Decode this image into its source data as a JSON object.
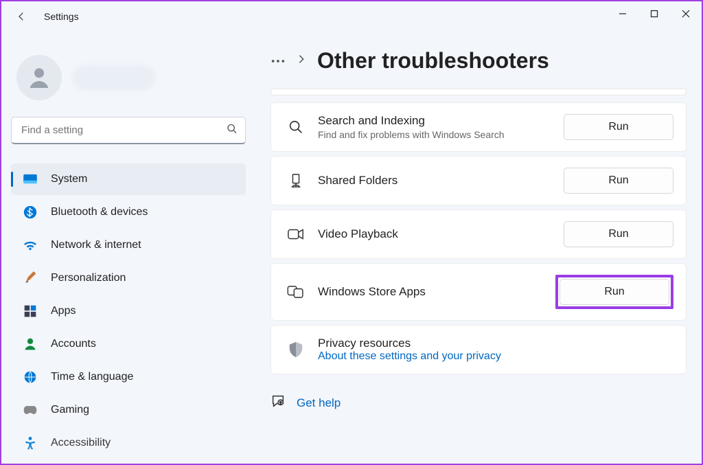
{
  "app_title": "Settings",
  "search": {
    "placeholder": "Find a setting"
  },
  "sidebar": {
    "items": [
      {
        "label": "System",
        "icon": "system",
        "selected": true
      },
      {
        "label": "Bluetooth & devices",
        "icon": "bluetooth"
      },
      {
        "label": "Network & internet",
        "icon": "wifi"
      },
      {
        "label": "Personalization",
        "icon": "brush"
      },
      {
        "label": "Apps",
        "icon": "apps"
      },
      {
        "label": "Accounts",
        "icon": "account"
      },
      {
        "label": "Time & language",
        "icon": "time"
      },
      {
        "label": "Gaming",
        "icon": "gaming"
      },
      {
        "label": "Accessibility",
        "icon": "accessibility"
      }
    ]
  },
  "page": {
    "title": "Other troubleshooters"
  },
  "troubleshooters": [
    {
      "title": "Search and Indexing",
      "subtitle": "Find and fix problems with Windows Search",
      "run": "Run",
      "icon": "search"
    },
    {
      "title": "Shared Folders",
      "subtitle": "",
      "run": "Run",
      "icon": "shared"
    },
    {
      "title": "Video Playback",
      "subtitle": "",
      "run": "Run",
      "icon": "video"
    },
    {
      "title": "Windows Store Apps",
      "subtitle": "",
      "run": "Run",
      "icon": "store",
      "highlighted": true
    }
  ],
  "privacy": {
    "title": "Privacy resources",
    "link": "About these settings and your privacy"
  },
  "gethelp": {
    "label": "Get help"
  }
}
